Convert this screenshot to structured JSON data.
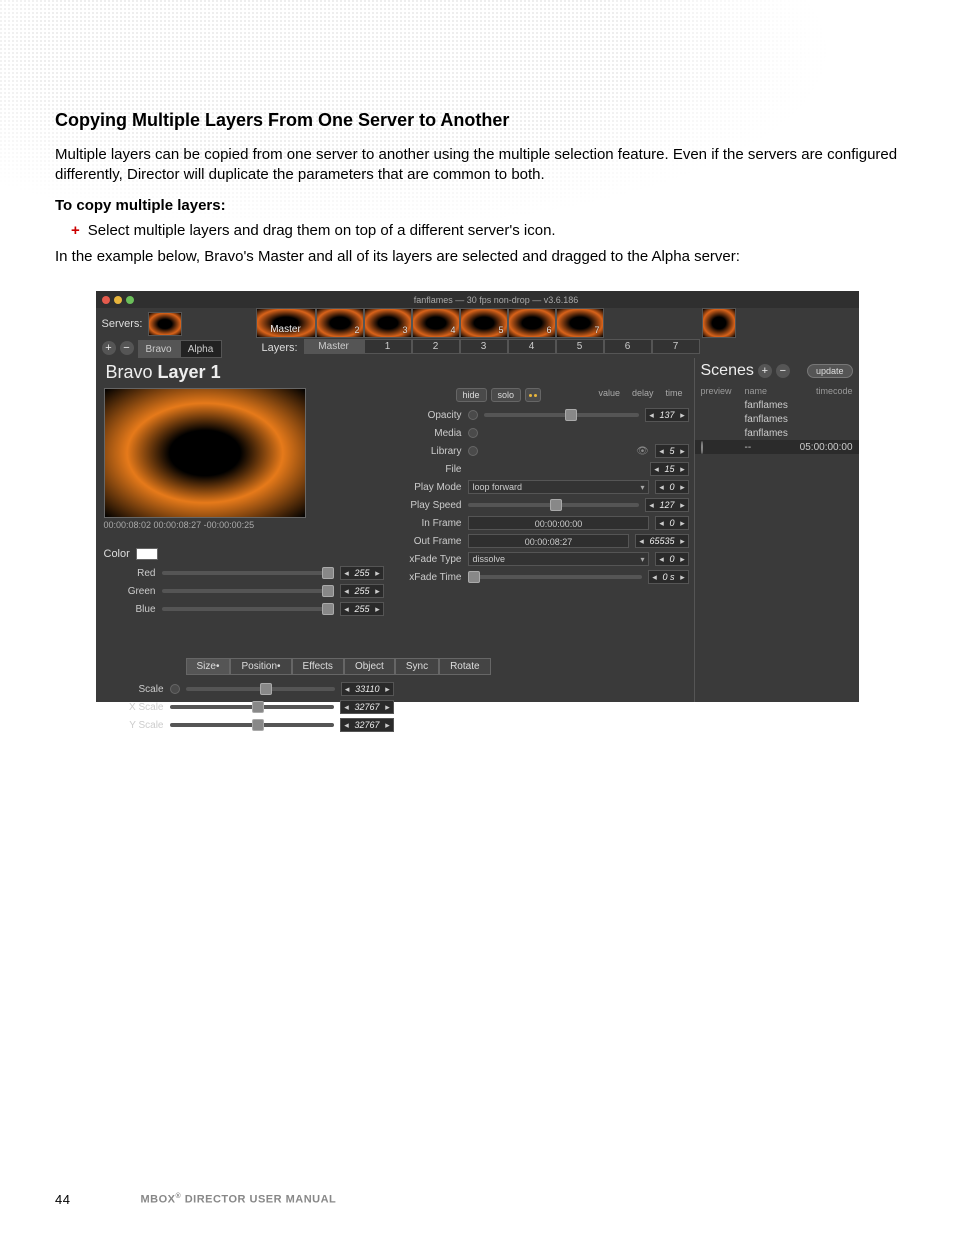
{
  "doc": {
    "section_title": "Copying Multiple Layers From One Server to Another",
    "para1": "Multiple layers can be copied from one server to another using the multiple selection feature. Even if the servers are configured differently, Director will duplicate the parameters that are common to both.",
    "subhead": "To copy multiple layers:",
    "bullet1": "Select multiple layers and drag them on top of a different server's icon.",
    "para2": "In the example below, Bravo's Master and all of its layers are selected and dragged to the Alpha server:",
    "page_num": "44",
    "footer": "MBOX",
    "footer_sup": "®",
    "footer_rest": " DIRECTOR USER MANUAL"
  },
  "ui": {
    "titlebar": "fanflames   —   30 fps non-drop   —   v3.6.186",
    "servers_label": "Servers:",
    "server_tabs": [
      "Bravo",
      "Alpha"
    ],
    "layers_label": "Layers:",
    "layer_tabs": [
      "Master",
      "1",
      "2",
      "3",
      "4",
      "5",
      "6",
      "7"
    ],
    "thumb_master": "Master",
    "thumb_nums": [
      "2",
      "3",
      "4",
      "5",
      "6",
      "7"
    ],
    "panel_title_a": "Bravo ",
    "panel_title_b": "Layer 1",
    "preview_time": "00:00:08:02   00:00:08:27   -00:00:00:25",
    "color_label": "Color",
    "red": "Red",
    "green": "Green",
    "blue": "Blue",
    "v255": "255",
    "btn_hide": "hide",
    "btn_solo": "solo",
    "head_value": "value",
    "head_delay": "delay",
    "head_time": "time",
    "p_opacity": "Opacity",
    "v_opacity": "137",
    "p_media": "Media",
    "p_library": "Library",
    "v_library": "5",
    "p_file": "File",
    "v_file": "15",
    "p_playmode": "Play Mode",
    "v_playmode": "loop forward",
    "v_pm_num": "0",
    "p_playspeed": "Play Speed",
    "v_playspeed": "127",
    "p_inframe": "In Frame",
    "v_inframe": "00:00:00:00",
    "v_in_num": "0",
    "p_outframe": "Out Frame",
    "v_outframe": "00:00:08:27",
    "v_out_num": "65535",
    "p_xfadetype": "xFade Type",
    "v_xfadetype": "dissolve",
    "v_xft_num": "0",
    "p_xfadetime": "xFade Time",
    "v_xfadetime": "0 s",
    "tabs": [
      "Size•",
      "Position•",
      "Effects",
      "Object",
      "Sync",
      "Rotate"
    ],
    "p_scale": "Scale",
    "v_scale": "33110",
    "p_xscale": "X Scale",
    "v_xscale": "32767",
    "p_yscale": "Y Scale",
    "v_yscale": "32767",
    "scenes_title": "Scenes",
    "update": "update",
    "sc_h1": "preview",
    "sc_h2": "name",
    "sc_h3": "timecode",
    "sc_name": "fanflames",
    "sc_dash": "--",
    "sc_time": "05:00:00:00"
  }
}
